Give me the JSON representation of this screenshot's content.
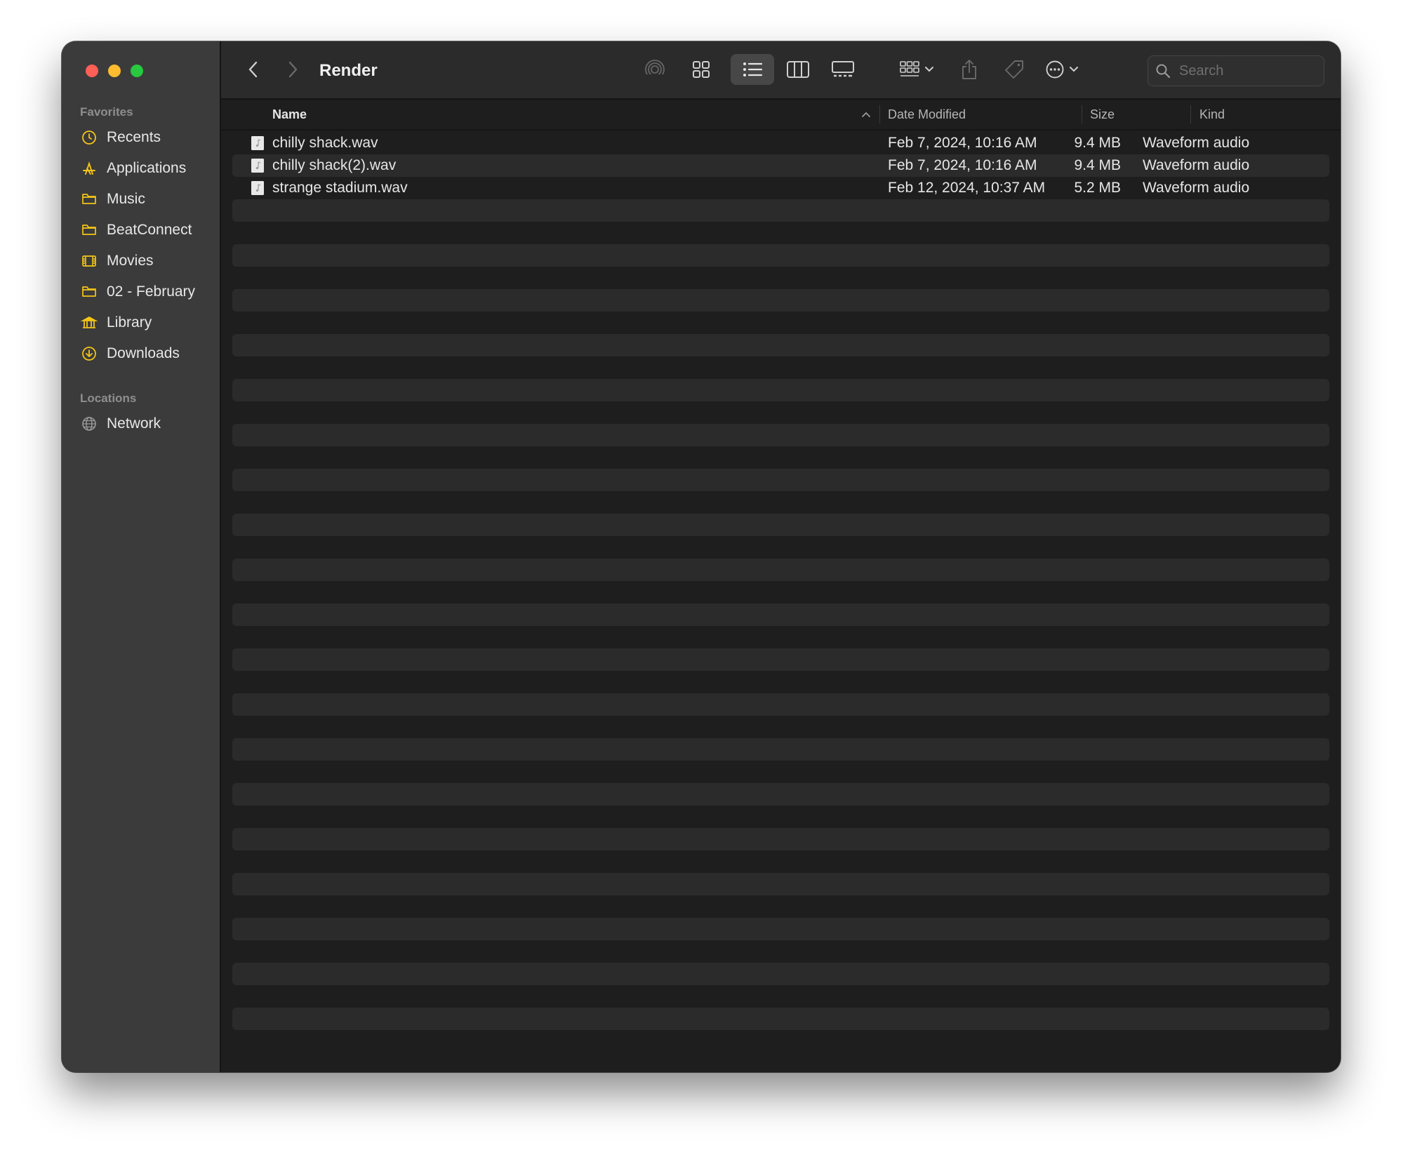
{
  "window": {
    "title": "Render"
  },
  "sidebar": {
    "favorites_heading": "Favorites",
    "favorites": [
      {
        "label": "Recents",
        "icon": "clock-icon"
      },
      {
        "label": "Applications",
        "icon": "applications-icon"
      },
      {
        "label": "Music",
        "icon": "folder-icon"
      },
      {
        "label": "BeatConnect",
        "icon": "folder-icon"
      },
      {
        "label": "Movies",
        "icon": "film-icon"
      },
      {
        "label": "02 - February",
        "icon": "folder-icon"
      },
      {
        "label": "Library",
        "icon": "library-icon"
      },
      {
        "label": "Downloads",
        "icon": "download-icon"
      }
    ],
    "locations_heading": "Locations",
    "locations": [
      {
        "label": "Network",
        "icon": "globe-icon"
      }
    ]
  },
  "toolbar": {
    "active_view": "list",
    "search_placeholder": "Search"
  },
  "columns": {
    "name": "Name",
    "date_modified": "Date Modified",
    "size": "Size",
    "kind": "Kind"
  },
  "files": [
    {
      "name": "chilly shack.wav",
      "date_modified": "Feb 7, 2024, 10:16 AM",
      "size": "9.4 MB",
      "kind": "Waveform audio"
    },
    {
      "name": "chilly shack(2).wav",
      "date_modified": "Feb 7, 2024, 10:16 AM",
      "size": "9.4 MB",
      "kind": "Waveform audio"
    },
    {
      "name": "strange stadium.wav",
      "date_modified": "Feb 12, 2024, 10:37 AM",
      "size": "5.2 MB",
      "kind": "Waveform audio"
    }
  ],
  "colors": {
    "accent_icon": "#f5c518",
    "close": "#fe5f57",
    "minimize": "#febc2e",
    "zoom": "#28c840"
  }
}
